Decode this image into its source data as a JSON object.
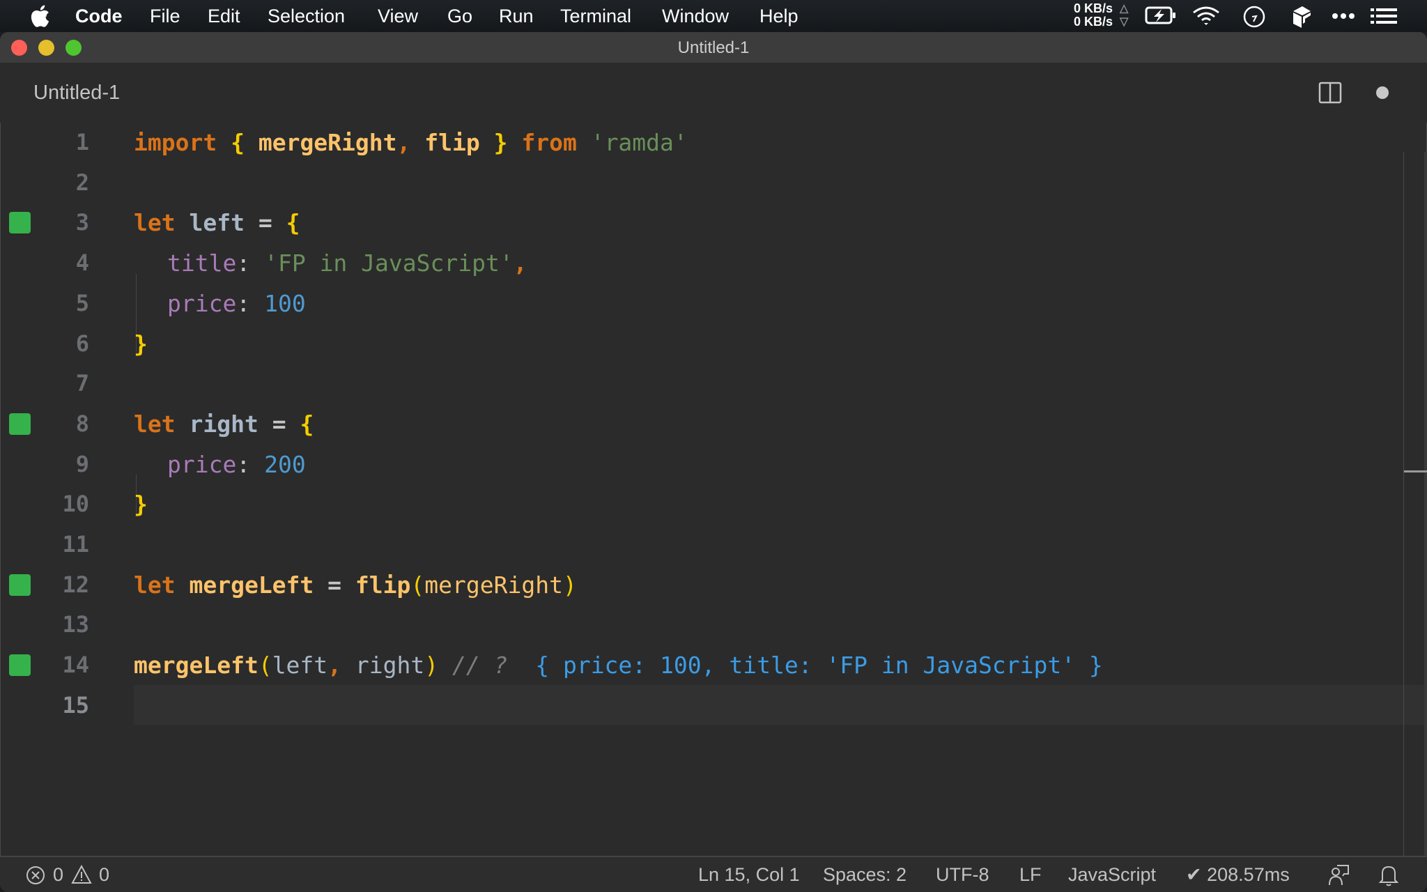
{
  "menubar": {
    "app_name": "Code",
    "items": [
      "File",
      "Edit",
      "Selection",
      "View",
      "Go",
      "Run",
      "Terminal",
      "Window",
      "Help"
    ],
    "network": {
      "upload": "0 KB/s",
      "download": "0 KB/s"
    },
    "tray_icons": [
      "battery-charging-icon",
      "wifi-icon",
      "clock-icon",
      "box-app-icon",
      "more-icon",
      "list-icon"
    ]
  },
  "window": {
    "title": "Untitled-1",
    "tab_label": "Untitled-1"
  },
  "editor": {
    "lines": [
      {
        "n": "1",
        "marker": false
      },
      {
        "n": "2",
        "marker": false
      },
      {
        "n": "3",
        "marker": true
      },
      {
        "n": "4",
        "marker": false
      },
      {
        "n": "5",
        "marker": false
      },
      {
        "n": "6",
        "marker": false
      },
      {
        "n": "7",
        "marker": false
      },
      {
        "n": "8",
        "marker": true
      },
      {
        "n": "9",
        "marker": false
      },
      {
        "n": "10",
        "marker": false
      },
      {
        "n": "11",
        "marker": false
      },
      {
        "n": "12",
        "marker": true
      },
      {
        "n": "13",
        "marker": false
      },
      {
        "n": "14",
        "marker": true
      },
      {
        "n": "15",
        "marker": false
      }
    ],
    "tokens": {
      "l1": [
        "import",
        " ",
        "{",
        " mergeRight",
        ",",
        " flip ",
        "}",
        " from",
        " 'ramda'"
      ],
      "l3": [
        "let",
        " left",
        " = ",
        "{"
      ],
      "l4": [
        "title",
        ": ",
        "'FP in JavaScript'",
        ","
      ],
      "l5": [
        "price",
        ": ",
        "100"
      ],
      "l6": [
        "}"
      ],
      "l8": [
        "let",
        " right",
        " = ",
        "{"
      ],
      "l9": [
        "price",
        ": ",
        "200"
      ],
      "l10": [
        "}"
      ],
      "l12": [
        "let",
        " mergeLeft",
        " = ",
        "flip",
        "(",
        "mergeRight",
        ")"
      ],
      "l14": [
        "mergeLeft",
        "(",
        "left",
        ",",
        " right",
        ")",
        " // ?",
        "  { price: 100, title: 'FP in JavaScript' }"
      ]
    },
    "current_line": 15
  },
  "statusbar": {
    "errors": "0",
    "warnings": "0",
    "position": "Ln 15, Col 1",
    "indent": "Spaces: 2",
    "encoding": "UTF-8",
    "eol": "LF",
    "language": "JavaScript",
    "timing": "✔ 208.57ms"
  },
  "colors": {
    "marker": "#35b24b",
    "keyword": "#d9731a",
    "brace": "#f5cc00",
    "function": "#fdc36a",
    "string": "#6a8f5a",
    "number": "#4f9ad0",
    "property": "#a97bb8",
    "result": "#3b9ce6"
  }
}
